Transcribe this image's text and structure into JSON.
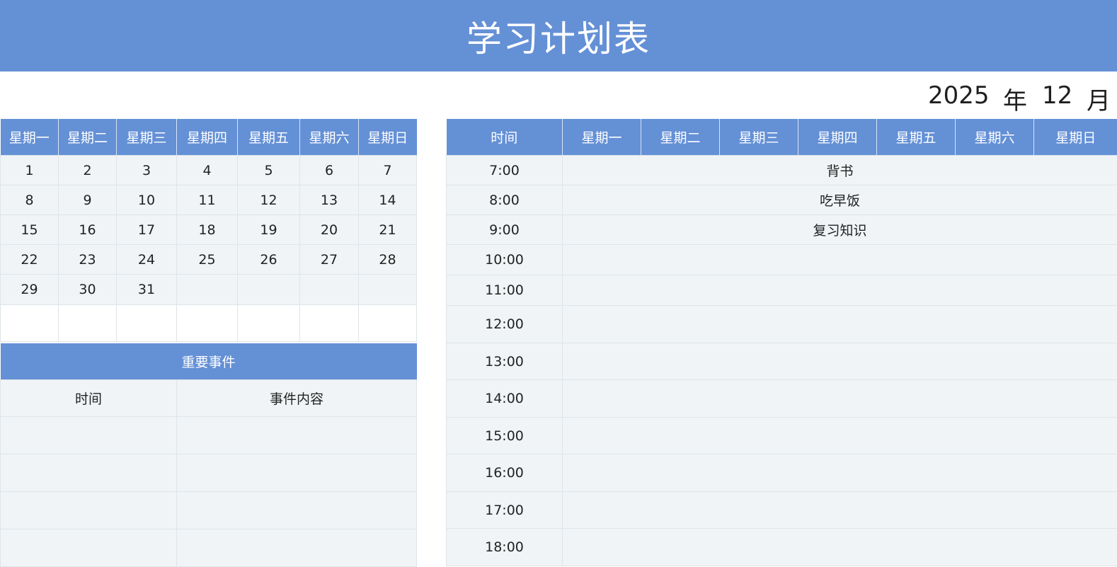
{
  "title": "学习计划表",
  "month": {
    "year": "2025",
    "year_unit": "年",
    "month": "12",
    "month_unit": "月"
  },
  "calendar": {
    "weekdays": [
      "星期一",
      "星期二",
      "星期三",
      "星期四",
      "星期五",
      "星期六",
      "星期日"
    ],
    "weeks": [
      [
        "1",
        "2",
        "3",
        "4",
        "5",
        "6",
        "7"
      ],
      [
        "8",
        "9",
        "10",
        "11",
        "12",
        "13",
        "14"
      ],
      [
        "15",
        "16",
        "17",
        "18",
        "19",
        "20",
        "21"
      ],
      [
        "22",
        "23",
        "24",
        "25",
        "26",
        "27",
        "28"
      ],
      [
        "29",
        "30",
        "31",
        "",
        "",
        "",
        ""
      ]
    ]
  },
  "events": {
    "title": "重要事件",
    "col_time": "时间",
    "col_content": "事件内容"
  },
  "schedule": {
    "time_header": "时间",
    "weekdays": [
      "星期一",
      "星期二",
      "星期三",
      "星期四",
      "星期五",
      "星期六",
      "星期日"
    ],
    "rows": [
      {
        "time": "7:00",
        "activity": "背书"
      },
      {
        "time": "8:00",
        "activity": "吃早饭"
      },
      {
        "time": "9:00",
        "activity": "复习知识"
      },
      {
        "time": "10:00",
        "activity": ""
      },
      {
        "time": "11:00",
        "activity": ""
      },
      {
        "time": "12:00",
        "activity": ""
      },
      {
        "time": "13:00",
        "activity": ""
      },
      {
        "time": "14:00",
        "activity": ""
      },
      {
        "time": "15:00",
        "activity": ""
      },
      {
        "time": "16:00",
        "activity": ""
      },
      {
        "time": "17:00",
        "activity": ""
      },
      {
        "time": "18:00",
        "activity": ""
      }
    ]
  },
  "colors": {
    "header_blue": "#6490d6",
    "cell_bg": "#f0f4f6",
    "grid_line": "#dde4e8"
  }
}
